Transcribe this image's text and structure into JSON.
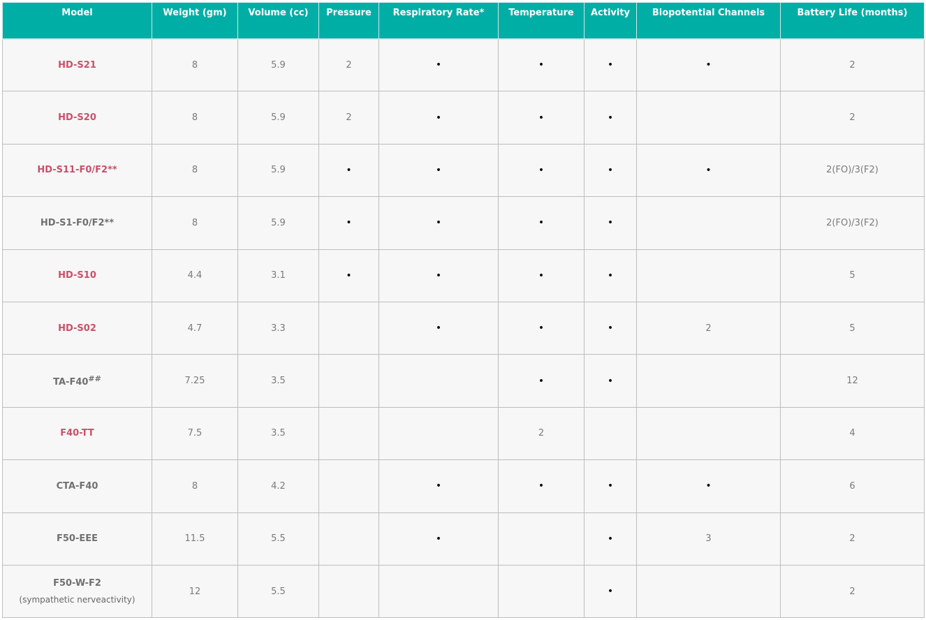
{
  "columns": [
    "Model",
    "Weight (gm)",
    "Volume (cc)",
    "Pressure",
    "Respiratory Rate*",
    "Temperature",
    "Activity",
    "Biopotential Channels",
    "Battery Life (months)"
  ],
  "dot": "•",
  "rows": [
    {
      "model": "HD-S21",
      "link": true,
      "weight": "8",
      "volume": "5.9",
      "pressure": "2",
      "resp": "•",
      "temp": "•",
      "activity": "•",
      "bio": "•",
      "battery": "2"
    },
    {
      "model": "HD-S20",
      "link": true,
      "weight": "8",
      "volume": "5.9",
      "pressure": "2",
      "resp": "•",
      "temp": "•",
      "activity": "•",
      "bio": "",
      "battery": "2"
    },
    {
      "model": "HD-S11-F0/F2**",
      "link": true,
      "weight": "8",
      "volume": "5.9",
      "pressure": "•",
      "resp": "•",
      "temp": "•",
      "activity": "•",
      "bio": "•",
      "battery": "2(FO)/3(F2)"
    },
    {
      "model": "HD-S1-F0/F2**",
      "link": false,
      "weight": "8",
      "volume": "5.9",
      "pressure": "•",
      "resp": "•",
      "temp": "•",
      "activity": "•",
      "bio": "",
      "battery": "2(FO)/3(F2)"
    },
    {
      "model": "HD-S10",
      "link": true,
      "weight": "4.4",
      "volume": "3.1",
      "pressure": "•",
      "resp": "•",
      "temp": "•",
      "activity": "•",
      "bio": "",
      "battery": "5"
    },
    {
      "model": "HD-S02",
      "link": true,
      "weight": "4.7",
      "volume": "3.3",
      "pressure": "",
      "resp": "•",
      "temp": "•",
      "activity": "•",
      "bio": "2",
      "battery": "5"
    },
    {
      "model": "TA-F40",
      "model_sup": "##",
      "link": false,
      "weight": "7.25",
      "volume": "3.5",
      "pressure": "",
      "resp": "",
      "temp": "•",
      "activity": "•",
      "bio": "",
      "battery": "12"
    },
    {
      "model": "F40-TT",
      "link": true,
      "weight": "7.5",
      "volume": "3.5",
      "pressure": "",
      "resp": "",
      "temp": "2",
      "activity": "",
      "bio": "",
      "battery": "4"
    },
    {
      "model": "CTA-F40",
      "link": false,
      "weight": "8",
      "volume": "4.2",
      "pressure": "",
      "resp": "•",
      "temp": "•",
      "activity": "•",
      "bio": "•",
      "battery": "6"
    },
    {
      "model": "F50-EEE",
      "link": false,
      "weight": "11.5",
      "volume": "5.5",
      "pressure": "",
      "resp": "•",
      "temp": "",
      "activity": "•",
      "bio": "3",
      "battery": "2"
    },
    {
      "model": "F50-W-F2",
      "model_note": "(sympathetic nerveactivity)",
      "link": false,
      "weight": "12",
      "volume": "5.5",
      "pressure": "",
      "resp": "",
      "temp": "",
      "activity": "•",
      "bio": "",
      "battery": "2"
    }
  ],
  "colors": {
    "header_bg": "#00aea6",
    "link_text": "#c7516a",
    "cell_bg": "#f7f7f7"
  }
}
